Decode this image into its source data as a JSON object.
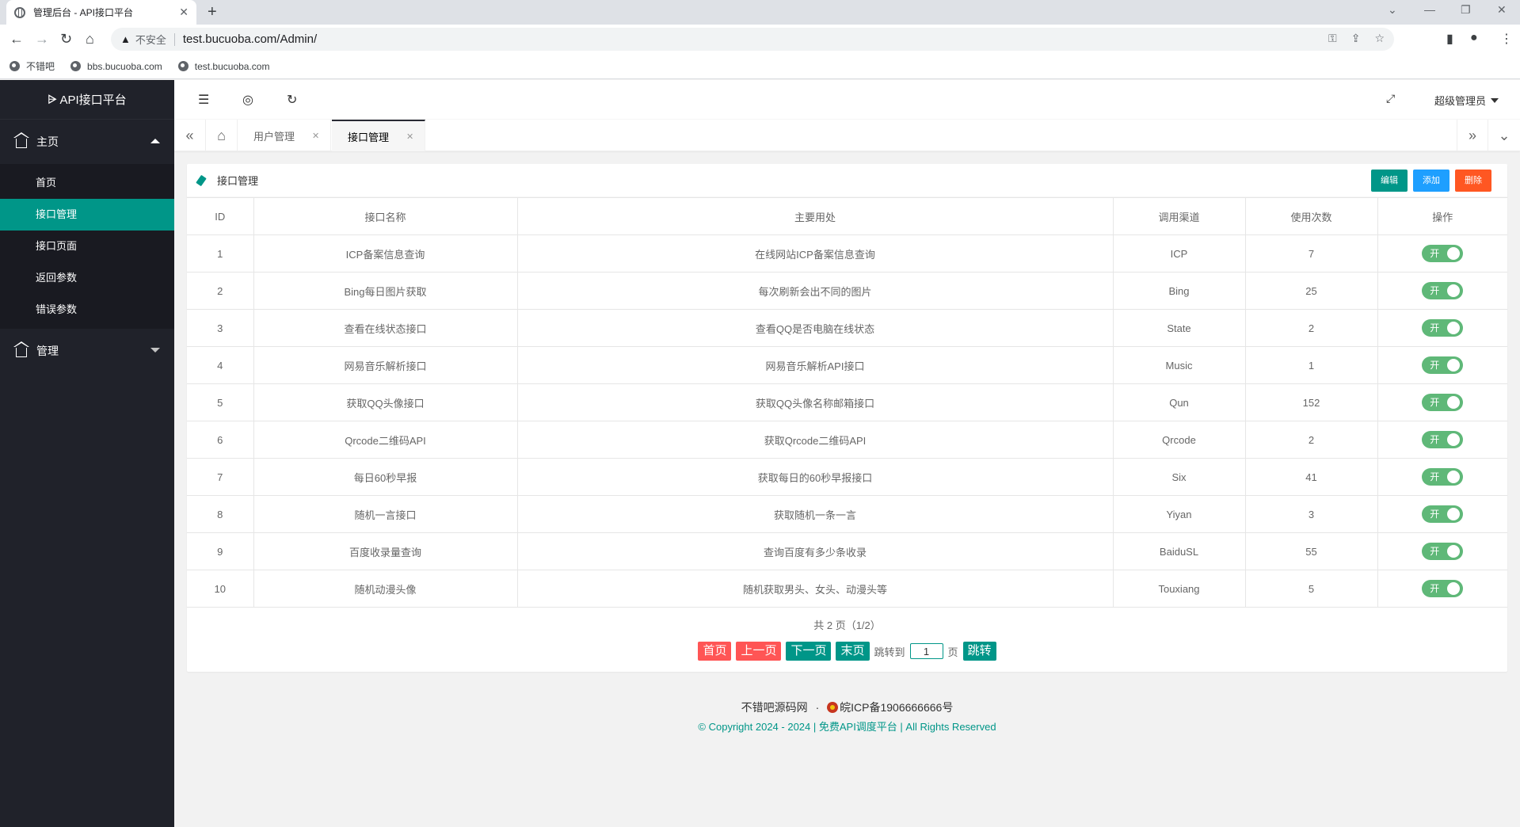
{
  "browser": {
    "tab_title": "管理后台 - API接口平台",
    "tab_close": "✕",
    "new_tab": "+",
    "insecure_label": "不安全",
    "url": "test.bucuoba.com/Admin/",
    "bookmarks": [
      "不错吧",
      "bbs.bucuoba.com",
      "test.bucuoba.com"
    ]
  },
  "sidebar": {
    "logo": "API接口平台",
    "group_home": "主页",
    "items": [
      "首页",
      "接口管理",
      "接口页面",
      "返回参数",
      "错误参数"
    ],
    "group_manage": "管理"
  },
  "header": {
    "user": "超级管理员"
  },
  "page_tabs": [
    {
      "label": "用户管理",
      "close": "✕"
    },
    {
      "label": "接口管理",
      "close": "✕"
    }
  ],
  "card": {
    "title": "接口管理",
    "buttons": {
      "edit": "编辑",
      "add": "添加",
      "delete": "删除"
    },
    "columns": [
      "ID",
      "接口名称",
      "主要用处",
      "调用渠道",
      "使用次数",
      "操作"
    ],
    "switch_label": "开",
    "rows": [
      {
        "id": "1",
        "name": "ICP备案信息查询",
        "use": "在线网站ICP备案信息查询",
        "channel": "ICP",
        "count": "7"
      },
      {
        "id": "2",
        "name": "Bing每日图片获取",
        "use": "每次刷新会出不同的图片",
        "channel": "Bing",
        "count": "25"
      },
      {
        "id": "3",
        "name": "查看在线状态接口",
        "use": "查看QQ是否电脑在线状态",
        "channel": "State",
        "count": "2"
      },
      {
        "id": "4",
        "name": "网易音乐解析接口",
        "use": "网易音乐解析API接口",
        "channel": "Music",
        "count": "1"
      },
      {
        "id": "5",
        "name": "获取QQ头像接口",
        "use": "获取QQ头像名称邮箱接口",
        "channel": "Qun",
        "count": "152"
      },
      {
        "id": "6",
        "name": "Qrcode二维码API",
        "use": "获取Qrcode二维码API",
        "channel": "Qrcode",
        "count": "2"
      },
      {
        "id": "7",
        "name": "每日60秒早报",
        "use": "获取每日的60秒早报接口",
        "channel": "Six",
        "count": "41"
      },
      {
        "id": "8",
        "name": "随机一言接口",
        "use": "获取随机一条一言",
        "channel": "Yiyan",
        "count": "3"
      },
      {
        "id": "9",
        "name": "百度收录量查询",
        "use": "查询百度有多少条收录",
        "channel": "BaiduSL",
        "count": "55"
      },
      {
        "id": "10",
        "name": "随机动漫头像",
        "use": "随机获取男头、女头、动漫头等",
        "channel": "Touxiang",
        "count": "5"
      }
    ]
  },
  "pager": {
    "info": "共 2 页（1/2）",
    "first": "首页",
    "prev": "上一页",
    "next": "下一页",
    "last": "末页",
    "jump_to": "跳转到",
    "page_value": "1",
    "page_unit": "页",
    "go": "跳转"
  },
  "footer": {
    "site": "不错吧源码网",
    "dot": "·",
    "icp": "皖ICP备1906666666号",
    "copyright": "© Copyright 2024 - 2024 | 免费API调度平台 | All Rights Reserved"
  }
}
